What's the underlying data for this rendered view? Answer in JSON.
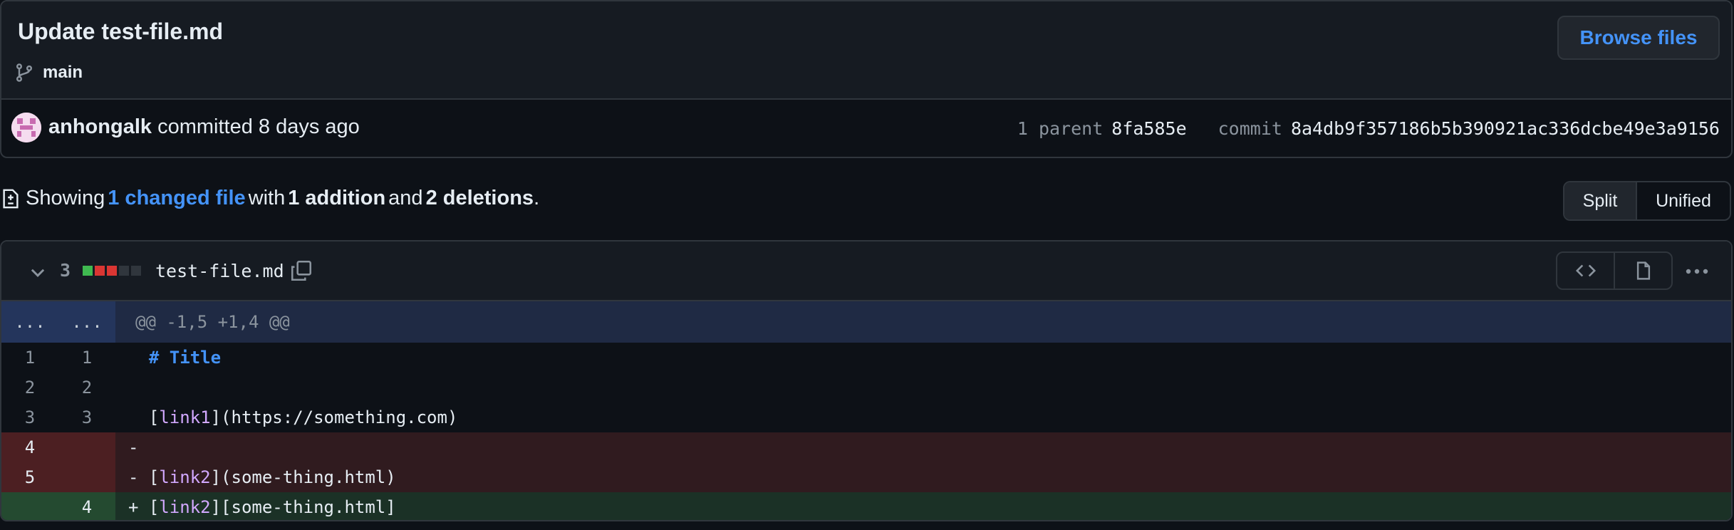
{
  "commit": {
    "title": "Update test-file.md",
    "branch": "main",
    "browse_label": "Browse files",
    "author": "anhongalk",
    "action_text": "committed 8 days ago",
    "parent_label": "1 parent",
    "parent_hash": "8fa585e",
    "commit_label": "commit",
    "commit_hash": "8a4db9f357186b5b390921ac336dcbe49e3a9156"
  },
  "summary": {
    "prefix": "Showing",
    "changed_link": "1 changed file",
    "with_text": "with",
    "additions": "1 addition",
    "and_text": "and",
    "deletions": "2 deletions",
    "suffix": "."
  },
  "view_toggle": {
    "split": "Split",
    "unified": "Unified",
    "active": "split"
  },
  "file": {
    "change_count": "3",
    "filename": "test-file.md",
    "diffstat": [
      "add",
      "del",
      "del",
      "neutral",
      "neutral"
    ],
    "colors": {
      "add": "#3fb950",
      "del": "#da3633",
      "neutral": "#30363d"
    }
  },
  "diff": {
    "hunk_old": "...",
    "hunk_new": "...",
    "hunk_header": "@@ -1,5 +1,4 @@",
    "rows": [
      {
        "type": "normal",
        "old": "1",
        "new": "1",
        "prefix": " ",
        "text": "# Title"
      },
      {
        "type": "normal",
        "old": "2",
        "new": "2",
        "prefix": " ",
        "text": ""
      },
      {
        "type": "normal",
        "old": "3",
        "new": "3",
        "prefix": " ",
        "text": "[link1](https://something.com)"
      },
      {
        "type": "del",
        "old": "4",
        "new": "",
        "prefix": "-",
        "text": ""
      },
      {
        "type": "del",
        "old": "5",
        "new": "",
        "prefix": "-",
        "text": "[link2](some-thing.html)"
      },
      {
        "type": "add",
        "old": "",
        "new": "4",
        "prefix": "+",
        "text": "[link2][some-thing.html]"
      }
    ]
  }
}
